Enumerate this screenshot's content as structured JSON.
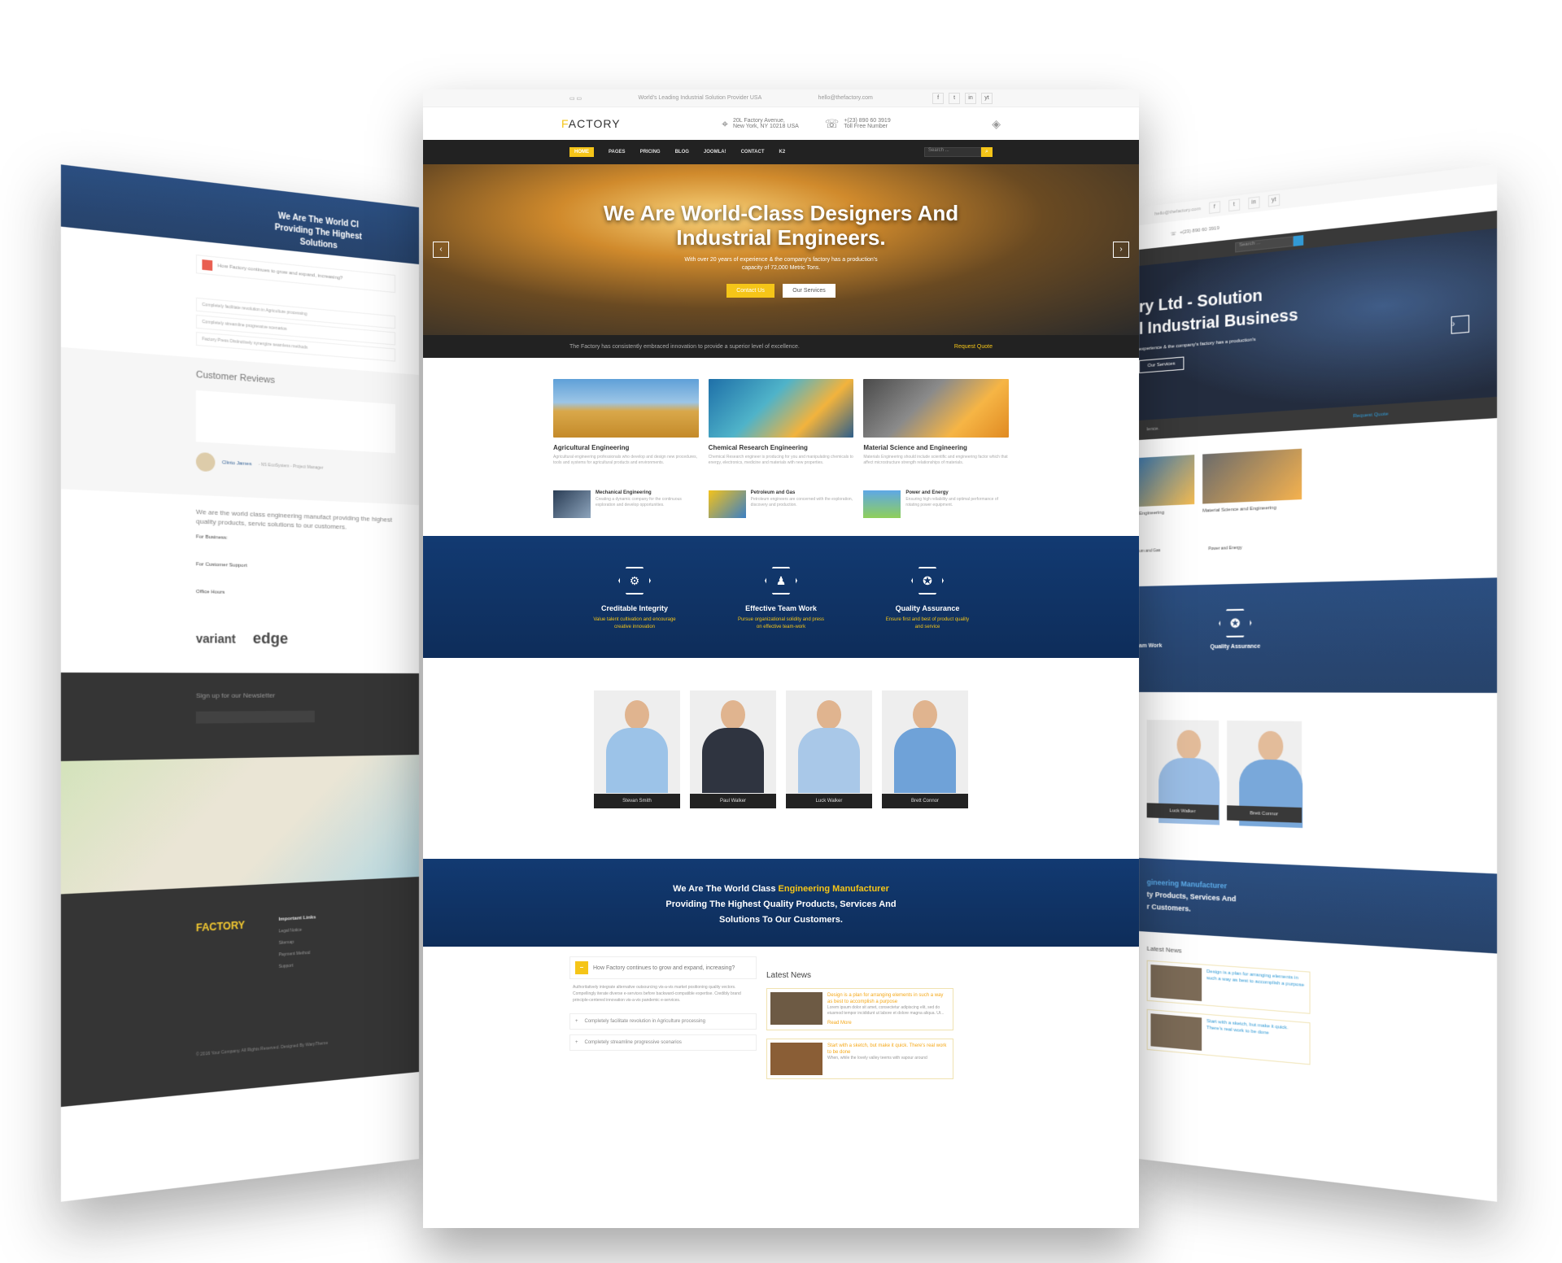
{
  "left": {
    "banner": [
      "We Are The World Cl",
      "Providing The Highest",
      "Solutions"
    ],
    "accordion": {
      "open": "How Factory continues to grow and expand, increasing?",
      "items": [
        "Completely facilitate revolution in Agriculture processing",
        "Completely streamline progressive scenarios",
        "Factory Press Distinctively synergize seamless methods"
      ]
    },
    "reviews_title": "Customer Reviews",
    "reviewer": "Clinto James",
    "reviewer_role": "- NS EcoSystem - Project Manager",
    "about": "We are the world class engineering manufact providing the highest quality products, servic solutions to our customers.",
    "business": "For Business:",
    "support": "For Customer Support",
    "hours": "Office Hours",
    "logos": [
      "variant",
      "edge"
    ],
    "newsletter": "Sign up for our Newsletter",
    "footer_logo": "FACTORY",
    "important_links": "Important Links",
    "links": [
      "Legal Notice",
      "Sitemap",
      "Payment Method",
      "Support"
    ],
    "copyright": "© 2016 Your Company. All Rights Reserved. Designed By WarpTheme"
  },
  "main": {
    "topbar": {
      "tagline": "World's Leading Industrial Solution Provider USA",
      "email": "hello@thefactory.com",
      "social": [
        "f",
        "t",
        "in",
        "yt"
      ]
    },
    "logo_first": "F",
    "logo_rest": "ACTORY",
    "address": [
      "20L Factory Avenue,",
      "New York, NY 10218 USA"
    ],
    "phone": [
      "+(23) 890 60 3919",
      "Toll Free Number"
    ],
    "nav": [
      "HOME",
      "PAGES",
      "PRICING",
      "BLOG",
      "JOOMLA!",
      "CONTACT",
      "K2"
    ],
    "search_placeholder": "Search ...",
    "hero": {
      "line1": "We Are World-Class Designers And",
      "line2": "Industrial Engineers.",
      "sub1": "With over 20 years of experience & the company's factory has a production's",
      "sub2": "capacity of 72,000 Metric Tons.",
      "btn1": "Contact Us",
      "btn2": "Our Services"
    },
    "strip": {
      "text": "The Factory has consistently embraced innovation to provide a superior level of excellence.",
      "link": "Request Quote"
    },
    "services": [
      {
        "title": "Agricultural Engineering",
        "text": "Agricultural engineering professionals who develop and design new procedures, tools and systems for agricultural products and environments."
      },
      {
        "title": "Chemical Research Engineering",
        "text": "Chemical Research engineer is producing for you and manipulating chemicals to energy, electronics, medicine and materials with new properties."
      },
      {
        "title": "Material Science and Engineering",
        "text": "Materials Engineering should include scientific and engineering factor which that affect microstructure strength relationships of materials."
      }
    ],
    "services2": [
      {
        "title": "Mechanical Engineering",
        "text": "Creating a dynamic company for the continuous exploration and develop opportunities."
      },
      {
        "title": "Petroleum and Gas",
        "text": "Petroleum engineers are concerned with the exploration, discovery and production."
      },
      {
        "title": "Power and Energy",
        "text": "Ensuring high reliability and optimal performance of rotating power equipment."
      }
    ],
    "features": [
      {
        "title": "Creditable Integrity",
        "text": "Value talent cultivation and encourage creative innovation"
      },
      {
        "title": "Effective Team Work",
        "text": "Pursue organizational solidity and press on effective team-work"
      },
      {
        "title": "Quality Assurance",
        "text": "Ensure first and best of product quality and service"
      }
    ],
    "team": [
      "Stevan Smith",
      "Paul Walker",
      "Luck Walker",
      "Brett Connor"
    ],
    "banner": {
      "l1a": "We Are The World Class ",
      "l1b": "Engineering Manufacturer",
      "l2": "Providing The Highest Quality Products, Services And",
      "l3": "Solutions To Our Customers."
    },
    "accordion": {
      "open": "How Factory continues to grow and expand, increasing?",
      "text": "Authoritatively integrate alternative outsourcing vis-a-vis market positioning quality vectors. Compellingly iterate diverse e-services before backward-compatible expertise. Credibly brand principle-centered innovation vis-a-vis pandemic e-services.",
      "items": [
        "Completely facilitate revolution in Agriculture processing",
        "Completely streamline progressive scenarios"
      ]
    },
    "news_title": "Latest News",
    "news": [
      {
        "title": "Design is a plan for arranging elements in such a way as best to accomplish a purpose",
        "text": "Lorem ipsum dolor sit amet, consectetur adipiscing elit, sed do eiusmod tempor incididunt ut labore et dolore magna aliqua. Ut...",
        "more": "Read More"
      },
      {
        "title": "Start with a sketch, but make it quick. There's real work to be done",
        "text": "When, while the lovely valley teems with vapour around"
      }
    ]
  },
  "right": {
    "email": "hello@thefactory.com",
    "phone": [
      "+(23) 890 60 3919",
      "Toll Free Number"
    ],
    "search_placeholder": "Search ...",
    "hero1": "ry Ltd - Solution",
    "hero2": "l Industrial Business",
    "hero_sub": "experience & the company's factory has a production's",
    "hero_btn": "Our Services",
    "strip": "lence.",
    "strip_link": "Request Quote",
    "svc": [
      "Engineering",
      "Material Science and Engineering"
    ],
    "svc2": [
      "um and Gas",
      "Power and Energy"
    ],
    "features": [
      "am Work",
      "Quality Assurance"
    ],
    "team": [
      "Luck Walker",
      "Brett Connor"
    ],
    "banner": [
      "gineering Manufacturer",
      "ty Products, Services And",
      "r Customers."
    ],
    "news_title": "Latest News",
    "news": [
      "Design is a plan for arranging elements in such a way as best to accomplish a purpose",
      "Start with a sketch, but make it quick. There's real work to be done"
    ]
  },
  "colors": {
    "accent": "#f5c518",
    "navy": "#123a72",
    "dark": "#1e1e1e"
  }
}
